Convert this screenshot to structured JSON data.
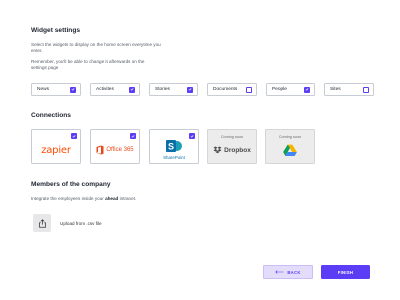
{
  "widget_settings": {
    "title": "Widget settings",
    "description_1": "Select the widgets to display on the home screen everytime you enter.",
    "description_2": "Remember, you'll be able to change it afterwards on the settings page",
    "widgets": [
      {
        "label": "News",
        "checked": true
      },
      {
        "label": "Activites",
        "checked": true
      },
      {
        "label": "Stories",
        "checked": true
      },
      {
        "label": "Documents",
        "checked": false
      },
      {
        "label": "People",
        "checked": true
      },
      {
        "label": "Sites",
        "checked": false
      }
    ]
  },
  "connections": {
    "title": "Connections",
    "items": [
      {
        "name": "zapier",
        "logo_text": "zapier",
        "checked": true,
        "coming_soon": false
      },
      {
        "name": "office365",
        "logo_text": "Office 365",
        "checked": true,
        "coming_soon": false
      },
      {
        "name": "sharepoint",
        "logo_text": "SharePoint",
        "checked": true,
        "coming_soon": false
      },
      {
        "name": "dropbox",
        "logo_text": "Dropbox",
        "badge": "Coming soon",
        "coming_soon": true
      },
      {
        "name": "google-drive",
        "badge": "Coming soon",
        "coming_soon": true
      }
    ]
  },
  "members": {
    "title": "Members of the company",
    "description_prefix": "Integrate the employees inside your ",
    "description_brand": "ahead",
    "description_suffix": " intranet.",
    "upload_label": "Upload from .csv file"
  },
  "footer": {
    "back_label": "BACK",
    "finish_label": "FINISH"
  },
  "colors": {
    "accent": "#5b3df5",
    "back_bg": "#e3ddfb",
    "disabled_card": "#ececec"
  }
}
